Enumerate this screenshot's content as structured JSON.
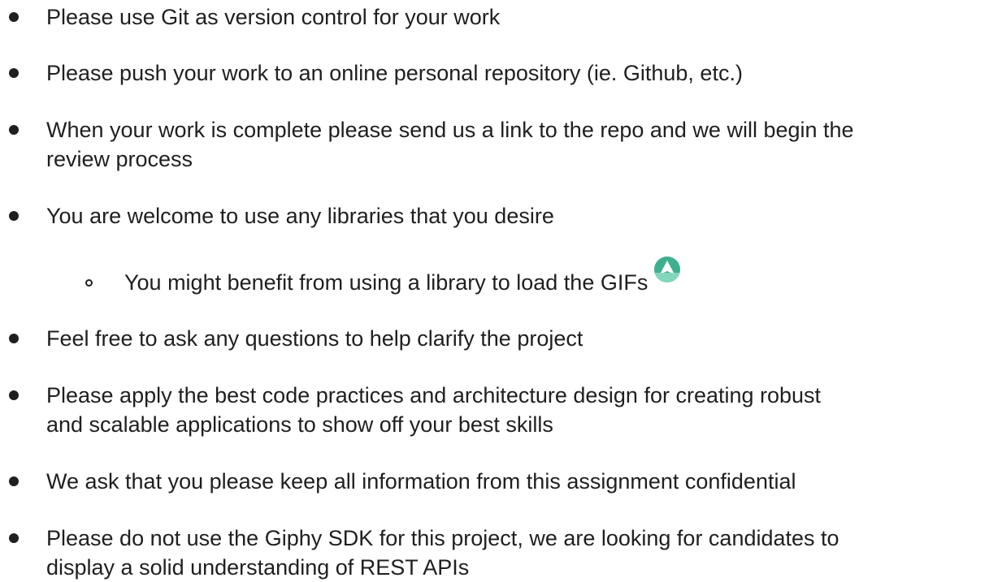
{
  "list": {
    "items": [
      {
        "lines": [
          "Please use Git as version control for your work"
        ]
      },
      {
        "lines": [
          "Please push your work to an online personal repository (ie. Github, etc.)"
        ]
      },
      {
        "lines": [
          "When your work is complete please send us a link to the repo and we will begin the",
          "review process"
        ]
      },
      {
        "lines": [
          "You are welcome to use any libraries that you desire"
        ]
      },
      {
        "lines": [
          "You might benefit from using a library to load the GIFs"
        ]
      },
      {
        "lines": [
          "Feel free to ask any questions to help clarify the project"
        ]
      },
      {
        "lines": [
          "Please apply the best code practices and architecture design for creating robust",
          "and scalable applications to show off your best skills"
        ]
      },
      {
        "lines": [
          "We ask that you please keep all information from this assignment confidential"
        ]
      },
      {
        "lines": [
          "Please do not use the Giphy SDK for this project, we are looking for candidates to",
          "display a solid understanding of REST APIs"
        ]
      }
    ]
  },
  "icons": {
    "paper_plane": "paper-plane-icon"
  },
  "colors": {
    "text": "#1f1f1f",
    "icon_green": "#3fb08f",
    "icon_light": "#8fdcc4"
  }
}
